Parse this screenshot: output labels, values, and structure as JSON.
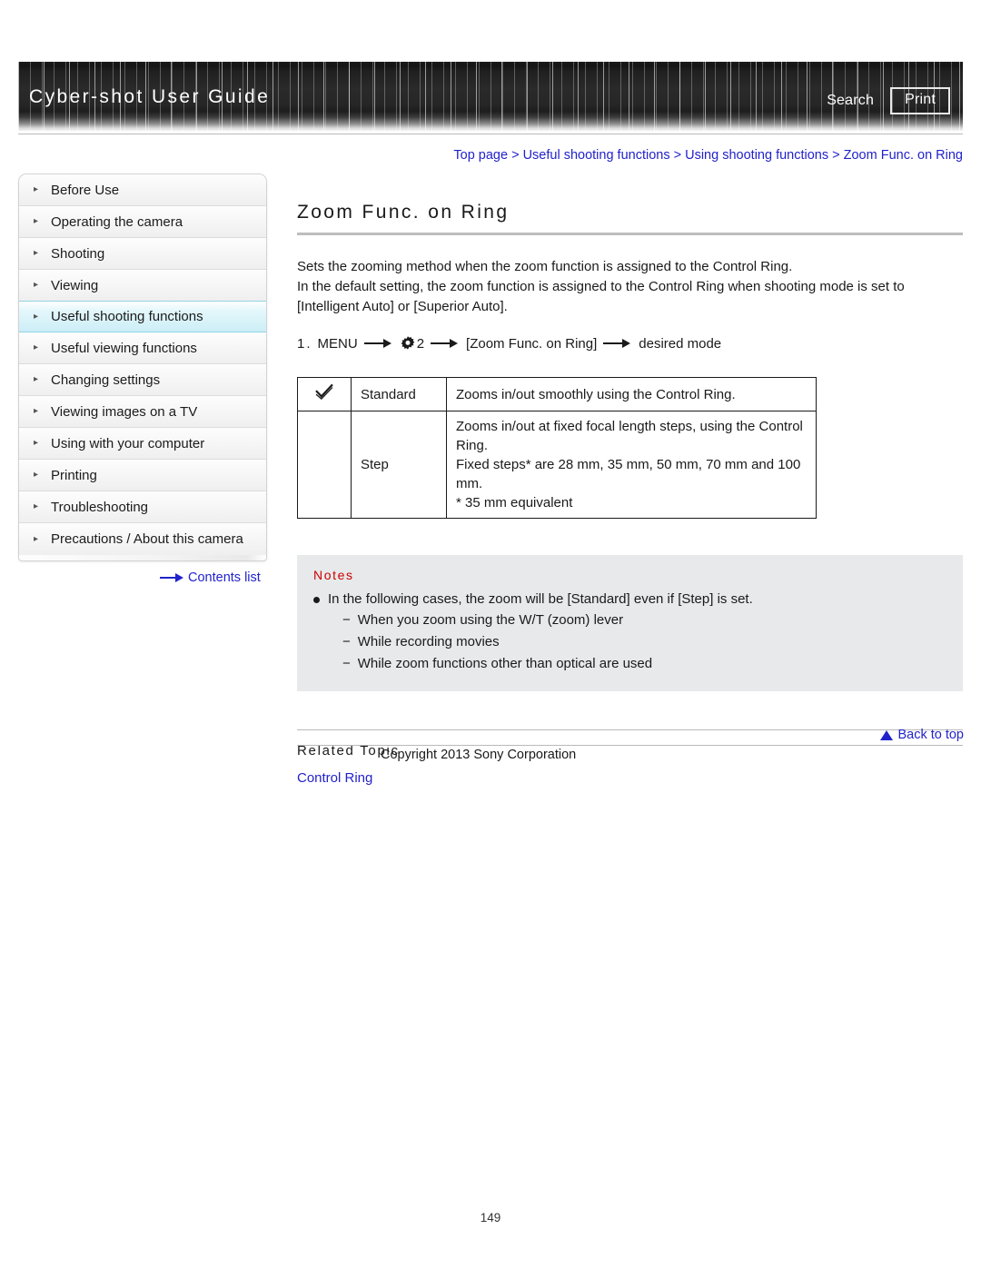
{
  "header": {
    "title": "Cyber-shot User Guide",
    "search_label": "Search",
    "print_label": "Print"
  },
  "breadcrumb": {
    "text": "Top page > Useful shooting functions > Using shooting functions > Zoom Func. on Ring"
  },
  "sidebar": {
    "items": [
      {
        "label": "Before Use",
        "active": false
      },
      {
        "label": "Operating the camera",
        "active": false
      },
      {
        "label": "Shooting",
        "active": false
      },
      {
        "label": "Viewing",
        "active": false
      },
      {
        "label": "Useful shooting functions",
        "active": true
      },
      {
        "label": "Useful viewing functions",
        "active": false
      },
      {
        "label": "Changing settings",
        "active": false
      },
      {
        "label": "Viewing images on a TV",
        "active": false
      },
      {
        "label": "Using with your computer",
        "active": false
      },
      {
        "label": "Printing",
        "active": false
      },
      {
        "label": "Troubleshooting",
        "active": false
      },
      {
        "label": "Precautions / About this camera",
        "active": false
      }
    ],
    "contents_list_label": "Contents list"
  },
  "main": {
    "title": "Zoom Func. on Ring",
    "paragraph1": "Sets the zooming method when the zoom function is assigned to the Control Ring.",
    "paragraph2": "In the default setting, the zoom function is assigned to the Control Ring when shooting mode is set to [Intelligent Auto] or [Superior Auto].",
    "step": {
      "number": "1.",
      "menu_label": "MENU",
      "gear_number": "2",
      "item_label": "[Zoom Func. on Ring]",
      "result_label": "desired mode"
    },
    "table": {
      "rows": [
        {
          "checked": true,
          "name": "Standard",
          "lines": [
            "Zooms in/out smoothly using the Control Ring."
          ]
        },
        {
          "checked": false,
          "name": "Step",
          "lines": [
            "Zooms in/out at fixed focal length steps, using the Control Ring.",
            "Fixed steps* are 28 mm, 35 mm, 50 mm, 70 mm and 100 mm.",
            "* 35 mm equivalent"
          ]
        }
      ]
    },
    "notes": {
      "title": "Notes",
      "main_item": "In the following cases, the zoom will be [Standard] even if [Step] is set.",
      "sub_items": [
        "When you zoom using the W/T (zoom) lever",
        "While recording movies",
        "While zoom functions other than optical are used"
      ]
    },
    "related": {
      "title": "Related Topic",
      "link": "Control Ring"
    }
  },
  "footer": {
    "back_to_top": "Back to top",
    "copyright": "Copyright 2013 Sony Corporation",
    "page_number": "149"
  },
  "colors": {
    "link": "#2222cc",
    "notes_title": "#cc0000",
    "active_nav": "#cdeef7",
    "notes_bg": "#e7e9eb"
  }
}
